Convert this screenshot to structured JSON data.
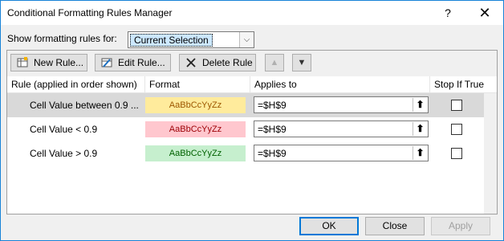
{
  "window": {
    "title": "Conditional Formatting Rules Manager",
    "help_glyph": "?",
    "close_glyph": "✕"
  },
  "show": {
    "label": "Show formatting rules for:",
    "selected": "Current Selection"
  },
  "toolbar": {
    "new_rule": "New Rule...",
    "edit_rule": "Edit Rule...",
    "delete_rule": "Delete Rule"
  },
  "columns": {
    "rule": "Rule (applied in order shown)",
    "format": "Format",
    "applies_to": "Applies to",
    "stop_if_true": "Stop If True"
  },
  "rules": [
    {
      "rule": "Cell Value between 0.9 ...",
      "format_preview": "AaBbCcYyZz",
      "format_bg": "#ffeb9c",
      "format_fg": "#9c5700",
      "applies_to": "=$H$9",
      "stop_if_true": false,
      "selected": true
    },
    {
      "rule": "Cell Value < 0.9",
      "format_preview": "AaBbCcYyZz",
      "format_bg": "#ffc7ce",
      "format_fg": "#9c0006",
      "applies_to": "=$H$9",
      "stop_if_true": false,
      "selected": false
    },
    {
      "rule": "Cell Value > 0.9",
      "format_preview": "AaBbCcYyZz",
      "format_bg": "#c6efce",
      "format_fg": "#006100",
      "applies_to": "=$H$9",
      "stop_if_true": false,
      "selected": false
    }
  ],
  "footer": {
    "ok": "OK",
    "close": "Close",
    "apply": "Apply"
  }
}
